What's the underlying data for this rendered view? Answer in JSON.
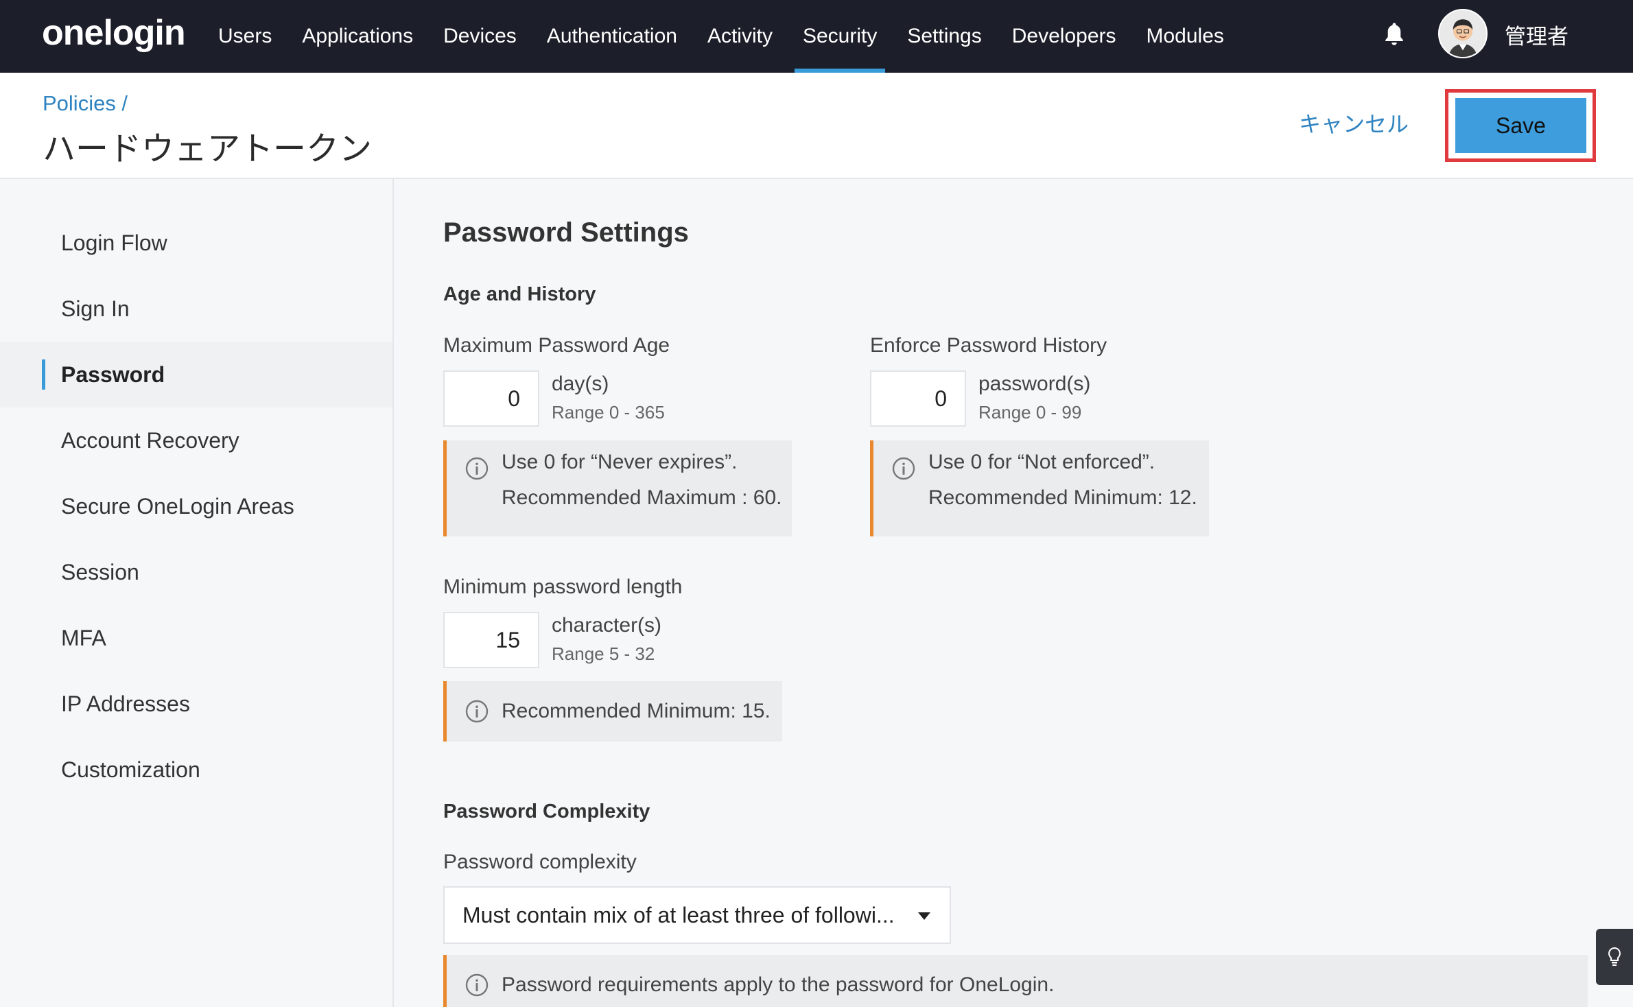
{
  "brand": {
    "logo": "onelogin"
  },
  "nav": {
    "items": [
      {
        "label": "Users"
      },
      {
        "label": "Applications"
      },
      {
        "label": "Devices"
      },
      {
        "label": "Authentication"
      },
      {
        "label": "Activity"
      },
      {
        "label": "Security",
        "active": true
      },
      {
        "label": "Settings"
      },
      {
        "label": "Developers"
      },
      {
        "label": "Modules"
      }
    ],
    "user_name": "管理者",
    "icons": [
      "bell-icon",
      "avatar"
    ]
  },
  "header": {
    "breadcrumb": "Policies /",
    "title": "ハードウェアトークン",
    "cancel_label": "キャンセル",
    "save_label": "Save"
  },
  "sidebar": {
    "items": [
      {
        "label": "Login Flow"
      },
      {
        "label": "Sign In"
      },
      {
        "label": "Password",
        "active": true
      },
      {
        "label": "Account Recovery"
      },
      {
        "label": "Secure OneLogin Areas"
      },
      {
        "label": "Session"
      },
      {
        "label": "MFA"
      },
      {
        "label": "IP Addresses"
      },
      {
        "label": "Customization"
      }
    ]
  },
  "main": {
    "section_title": "Password Settings",
    "age_history": {
      "heading": "Age and History",
      "max_age": {
        "label": "Maximum Password Age",
        "value": "0",
        "unit": "day(s)",
        "range": "Range 0 - 365",
        "info_line1": "Use 0 for “Never expires”.",
        "info_line2": "Recommended Maximum : 60."
      },
      "history": {
        "label": "Enforce Password History",
        "value": "0",
        "unit": "password(s)",
        "range": "Range 0 - 99",
        "info_line1": "Use 0 for “Not enforced”.",
        "info_line2": "Recommended Minimum: 12."
      },
      "min_length": {
        "label": "Minimum password length",
        "value": "15",
        "unit": "character(s)",
        "range": "Range 5 - 32",
        "info_line1": "Recommended Minimum: 15."
      }
    },
    "complexity": {
      "heading": "Password Complexity",
      "label": "Password complexity",
      "selected": "Must contain mix of at least three of followi...",
      "info": "Password requirements apply to the password for OneLogin."
    }
  },
  "colors": {
    "nav_bg": "#1c1f2a",
    "accent": "#3a9bd9",
    "save_button": "#3d9ddd",
    "highlight_outline": "#e0393e",
    "info_border": "#e8892f"
  }
}
